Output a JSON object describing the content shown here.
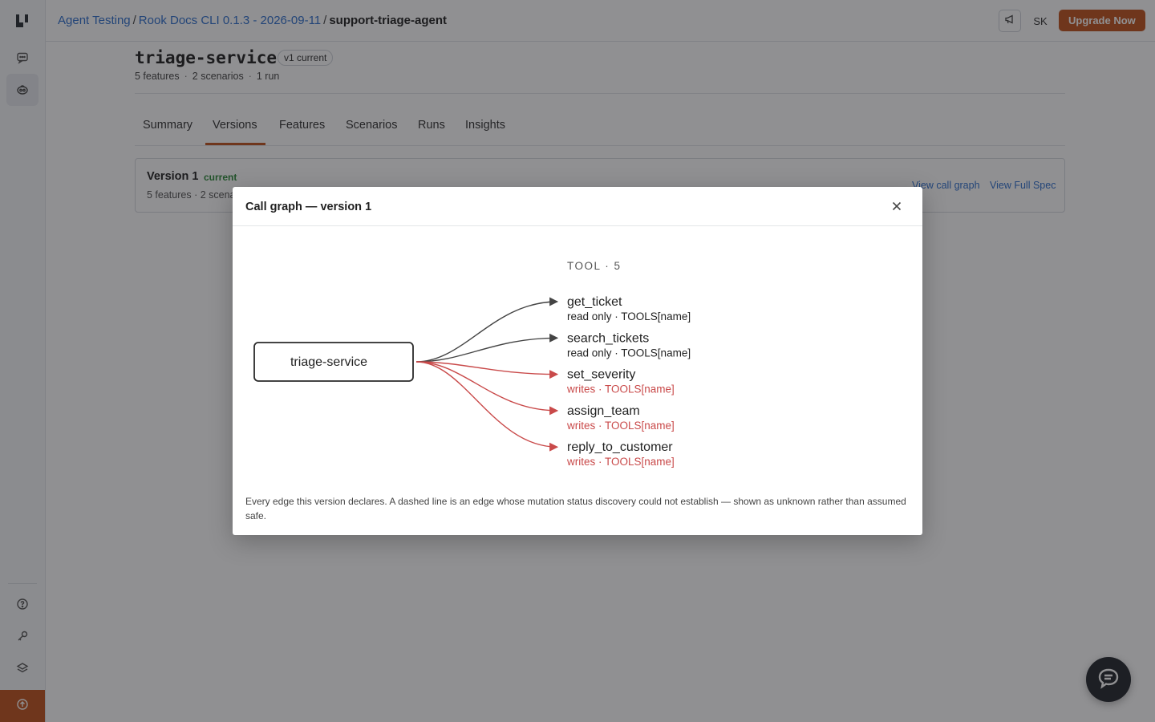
{
  "colors": {
    "accent": "#c0531d",
    "link": "#2e6fce",
    "success": "#2f8a3b",
    "write_edge": "#c94a4a",
    "read_edge": "#444444"
  },
  "sidebar": {
    "logo_icon": "app-logo-icon",
    "items": [
      {
        "name": "chat",
        "icon": "chat-icon"
      },
      {
        "name": "agent-testing",
        "icon": "robot-icon"
      },
      {
        "name": "help",
        "icon": "help-circle-icon"
      },
      {
        "name": "keys",
        "icon": "key-icon"
      },
      {
        "name": "layers",
        "icon": "layers-icon"
      }
    ],
    "upgrade_icon": "arrow-up-circle-icon"
  },
  "topbar": {
    "breadcrumb": [
      "Agent Testing",
      "Rook Docs CLI 0.1.3 - 2026-09-11",
      "support-triage-agent"
    ],
    "separator": "/",
    "announce_icon": "megaphone-icon",
    "avatar_initials": "SK",
    "upgrade_label": "Upgrade Now"
  },
  "service": {
    "name": "triage-service",
    "version_badge": "v1 current",
    "meta": [
      "5 features",
      "2 scenarios",
      "1 run"
    ],
    "meta_sep": "·"
  },
  "tabs": [
    {
      "label": "Summary"
    },
    {
      "label": "Versions",
      "active": true
    },
    {
      "label": "Features"
    },
    {
      "label": "Scenarios"
    },
    {
      "label": "Runs"
    },
    {
      "label": "Insights"
    }
  ],
  "version_card": {
    "title": "Version 1",
    "status": "current",
    "meta": "5 features · 2 scena",
    "view_call_graph": "View call graph",
    "view_full_spec": "View Full Spec"
  },
  "modal": {
    "title": "Call graph — version 1",
    "close_icon": "close-icon",
    "caption": "Every edge this version declares. A dashed line is an edge whose mutation status discovery could not establish — shown as unknown rather than assumed safe."
  },
  "call_graph": {
    "source": "triage-service",
    "column_header": "TOOL · 5",
    "tools": [
      {
        "name": "get_ticket",
        "detail": "read only · TOOLS[name]",
        "mutation": "read"
      },
      {
        "name": "search_tickets",
        "detail": "read only · TOOLS[name]",
        "mutation": "read"
      },
      {
        "name": "set_severity",
        "detail": "writes · TOOLS[name]",
        "mutation": "write"
      },
      {
        "name": "assign_team",
        "detail": "writes · TOOLS[name]",
        "mutation": "write"
      },
      {
        "name": "reply_to_customer",
        "detail": "writes · TOOLS[name]",
        "mutation": "write"
      }
    ]
  },
  "chat_widget": {
    "icon": "chat-bubble-icon"
  }
}
